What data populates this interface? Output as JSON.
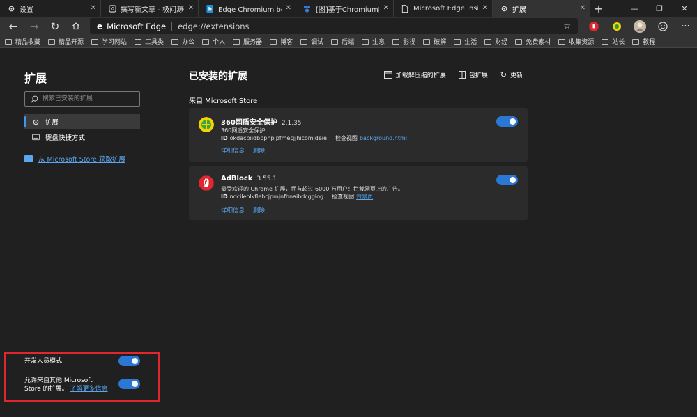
{
  "tabs": [
    {
      "label": "设置",
      "icon": "gear-icon",
      "active": false
    },
    {
      "label": "撰写新文章 - 极问源码 - F",
      "icon": "page-icon",
      "active": false
    },
    {
      "label": "Edge Chromium beta新特",
      "icon": "bing-icon",
      "active": false
    },
    {
      "label": "[图]基于Chromium的Edge",
      "icon": "paw-icon",
      "active": false
    },
    {
      "label": "Microsoft Edge Insider",
      "icon": "page-icon",
      "active": false
    },
    {
      "label": "扩展",
      "icon": "puzzle-icon",
      "active": true
    }
  ],
  "tab_close": "✕",
  "new_tab": "+",
  "window_controls": {
    "minimize": "—",
    "maximize": "❐",
    "close": "✕"
  },
  "address": {
    "brand": "Microsoft Edge",
    "url": "edge://extensions"
  },
  "bookmarks": [
    "精品收藏",
    "精品开源",
    "学习网站",
    "工具类",
    "办公",
    "个人",
    "服务器",
    "博客",
    "调试",
    "后端",
    "生意",
    "影视",
    "破解",
    "生活",
    "财经",
    "免费素材",
    "收集资源",
    "站长",
    "教程"
  ],
  "sidebar": {
    "title": "扩展",
    "search_placeholder": "搜索已安装的扩展",
    "items": [
      {
        "label": "扩展",
        "active": true
      },
      {
        "label": "键盘快捷方式",
        "active": false
      }
    ],
    "store_link": "从 Microsoft Store 获取扩展",
    "dev_mode_label": "开发人员模式",
    "dev_mode_on": true,
    "allow_other_line1": "允许来自其他 Microsoft",
    "allow_other_line2": "Store 的扩展。",
    "learn_more": "了解更多信息",
    "allow_other_on": true
  },
  "main": {
    "title": "已安装的扩展",
    "actions": {
      "load_unpacked": "加载解压缩的扩展",
      "pack": "包扩展",
      "update": "更新"
    },
    "section_label": "来自 Microsoft Store",
    "extensions": [
      {
        "name": "360网盾安全保护",
        "version": "2.1.35",
        "description": "360网盾安全保护",
        "id_label": "ID",
        "id": "okdacpiidbbphpjpfmecjjhicomjdeie",
        "inspect_label": "检查视图",
        "inspect_link": "background.html",
        "details": "详细信息",
        "remove": "删除",
        "enabled": true
      },
      {
        "name": "AdBlock",
        "version": "3.55.1",
        "description": "最受欢迎的 Chrome 扩展，拥有超过 6000 万用户！拦截网页上的广告。",
        "id_label": "ID",
        "id": "ndcileolkflehcjpmjnfbnaibdcgglog",
        "inspect_label": "检查视图",
        "inspect_link": "背景页",
        "details": "详细信息",
        "remove": "删除",
        "enabled": true
      }
    ]
  },
  "colors": {
    "accent": "#2b78d4",
    "link": "#5aa6f0",
    "highlight_box": "#e0262f"
  }
}
